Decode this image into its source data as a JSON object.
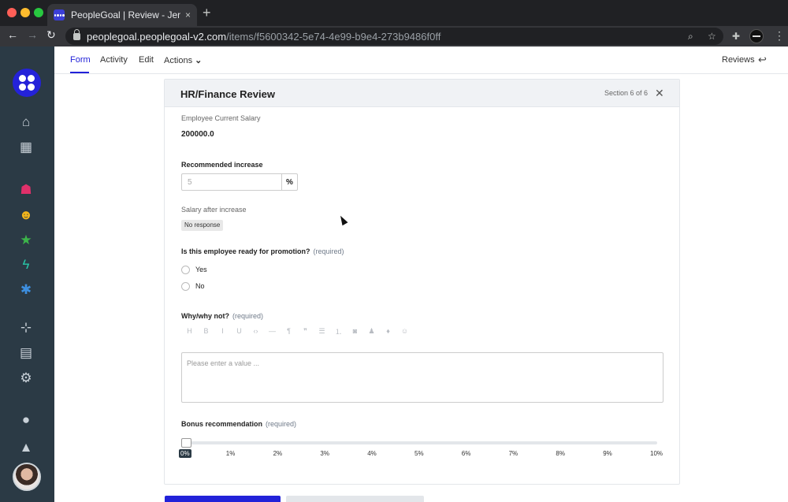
{
  "browser": {
    "tab_title": "PeopleGoal | Review - Jenny Jo",
    "tab_close": "×",
    "new_tab": "+",
    "url_host": "peoplegoal.peoplegoal-v2.com",
    "url_path": "/items/f5600342-5e74-4e99-b9e4-273b9486f0ff",
    "back": "←",
    "forward": "→",
    "reload": "↻",
    "zoom_icon": "⌕",
    "star_icon": "☆",
    "extensions_icon": "✚",
    "menu_icon": "⋮"
  },
  "sidebar": {
    "items": [
      {
        "name": "home-icon",
        "glyph": "⌂",
        "color": "#c9d1d8"
      },
      {
        "name": "grid-icon",
        "glyph": "▦",
        "color": "#c9d1d8"
      },
      {
        "name": "team-icon",
        "glyph": "☗",
        "color": "#e0306a"
      },
      {
        "name": "user-edit-icon",
        "glyph": "☻",
        "color": "#f2b51c"
      },
      {
        "name": "star-icon",
        "glyph": "★",
        "color": "#3cb54a"
      },
      {
        "name": "bolt-icon",
        "glyph": "ϟ",
        "color": "#28c7a8"
      },
      {
        "name": "asterisk-icon",
        "glyph": "✱",
        "color": "#3d8fe0"
      },
      {
        "name": "org-chart-icon",
        "glyph": "⊹",
        "color": "#c9d1d8"
      },
      {
        "name": "table-icon",
        "glyph": "▤",
        "color": "#c9d1d8"
      },
      {
        "name": "settings-icon",
        "glyph": "⚙",
        "color": "#c9d1d8"
      },
      {
        "name": "lightbulb-icon",
        "glyph": "●",
        "color": "#c9d1d8"
      },
      {
        "name": "bell-icon",
        "glyph": "▲",
        "color": "#c9d1d8"
      }
    ]
  },
  "topnav": {
    "form": "Form",
    "activity": "Activity",
    "edit": "Edit",
    "actions": "Actions",
    "actions_caret": "⌄",
    "reviews": "Reviews",
    "reviews_icon": "↩"
  },
  "section": {
    "title": "HR/Finance Review",
    "count": "Section 6 of 6",
    "close": "✕"
  },
  "fields": {
    "current_salary_label": "Employee Current Salary",
    "current_salary_value": "200000.0",
    "increase_label": "Recommended increase",
    "increase_placeholder": "5",
    "increase_unit": "%",
    "after_increase_label": "Salary after increase",
    "after_increase_value": "No response",
    "promotion_label": "Is this employee ready for promotion?",
    "required": "(required)",
    "promotion_options": [
      "Yes",
      "No"
    ],
    "why_label": "Why/why not?",
    "why_placeholder": "Please enter a value ...",
    "bonus_label": "Bonus recommendation",
    "bonus_value_percent": 0
  },
  "rte_toolbar": [
    {
      "name": "heading-icon",
      "glyph": "H"
    },
    {
      "name": "bold-icon",
      "glyph": "B"
    },
    {
      "name": "italic-icon",
      "glyph": "I"
    },
    {
      "name": "underline-icon",
      "glyph": "U"
    },
    {
      "name": "code-icon",
      "glyph": "‹›"
    },
    {
      "name": "horizontal-rule-icon",
      "glyph": "—"
    },
    {
      "name": "paragraph-icon",
      "glyph": "¶"
    },
    {
      "name": "quote-icon",
      "glyph": "❞"
    },
    {
      "name": "bullet-list-icon",
      "glyph": "☰"
    },
    {
      "name": "numbered-list-icon",
      "glyph": "⒈"
    },
    {
      "name": "camera-icon",
      "glyph": "◙"
    },
    {
      "name": "person-icon",
      "glyph": "♟"
    },
    {
      "name": "drop-icon",
      "glyph": "♦"
    },
    {
      "name": "emoji-icon",
      "glyph": "☺"
    }
  ],
  "slider_ticks": [
    "0%",
    "1%",
    "2%",
    "3%",
    "4%",
    "5%",
    "6%",
    "7%",
    "8%",
    "9%",
    "10%"
  ]
}
